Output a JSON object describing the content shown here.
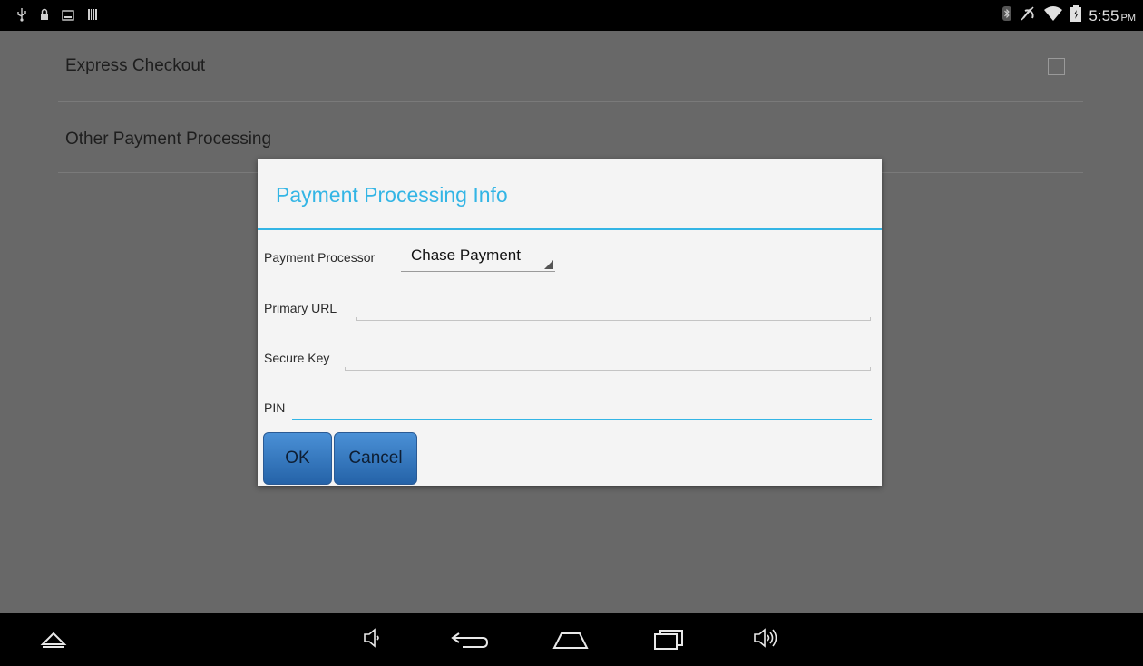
{
  "status_bar": {
    "left_icons": [
      "usb-icon",
      "lock-icon",
      "image-icon",
      "barcode-icon"
    ],
    "right_icons": [
      "bluetooth-icon",
      "mute-icon",
      "wifi-icon",
      "battery-icon"
    ],
    "time": "5:55",
    "ampm": "PM"
  },
  "settings": {
    "express_checkout_label": "Express Checkout",
    "other_payment_label": "Other Payment Processing"
  },
  "dialog": {
    "title": "Payment Processing Info",
    "processor_label": "Payment Processor",
    "processor_value": "Chase Payment",
    "primary_url_label": "Primary URL",
    "primary_url_value": "",
    "secure_key_label": "Secure Key",
    "secure_key_value": "",
    "pin_label": "PIN",
    "pin_value": "",
    "ok_label": "OK",
    "cancel_label": "Cancel"
  },
  "nav_bar": {
    "icons": [
      "up-chevron-icon",
      "volume-down-icon",
      "back-icon",
      "home-icon",
      "recents-icon",
      "volume-up-icon"
    ]
  },
  "colors": {
    "accent": "#33b5e5",
    "button": "#3677c0",
    "background_dim": "#686868"
  }
}
